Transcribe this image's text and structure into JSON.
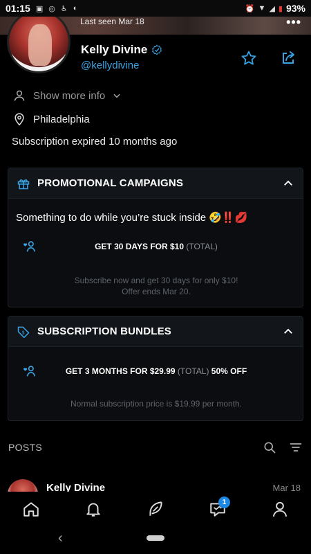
{
  "status_bar": {
    "time": "01:15",
    "battery": "93%",
    "icons": [
      "media-icon",
      "instagram-icon",
      "accessibility-icon",
      "sync-icon",
      "alarm-icon",
      "wifi-icon",
      "signal-icon",
      "battery-icon"
    ]
  },
  "cover": {
    "last_seen": "Last seen Mar 18",
    "menu": "•••"
  },
  "profile": {
    "name": "Kelly Divine",
    "handle": "@kellydivine",
    "show_more": "Show more info",
    "location": "Philadelphia",
    "subscription_status": "Subscription expired 10 months ago"
  },
  "promotional_campaigns": {
    "title": "PROMOTIONAL CAMPAIGNS",
    "message": "Something to do while you’re stuck inside",
    "message_emojis": "🤣‼️💋",
    "deal_main": "GET 30 DAYS FOR $10",
    "deal_total": "(TOTAL)",
    "note_line1": "Subscribe now and get 30 days for only $10!",
    "note_line2": "Offer ends Mar 20."
  },
  "subscription_bundles": {
    "title": "SUBSCRIPTION BUNDLES",
    "deal_main": "GET 3 MONTHS FOR $29.99",
    "deal_total": "(TOTAL)",
    "deal_discount": "50% OFF",
    "note": "Normal subscription price is $19.99 per month."
  },
  "posts": {
    "title": "POSTS",
    "preview_name": "Kelly Divine",
    "preview_date": "Mar 18"
  },
  "bottom_nav": {
    "messages_badge": "1"
  },
  "android_nav": {
    "back": "‹"
  },
  "colors": {
    "accent": "#3aa3e3",
    "background": "#000000",
    "card": "#0c0d10",
    "badge": "#1e88e5"
  }
}
